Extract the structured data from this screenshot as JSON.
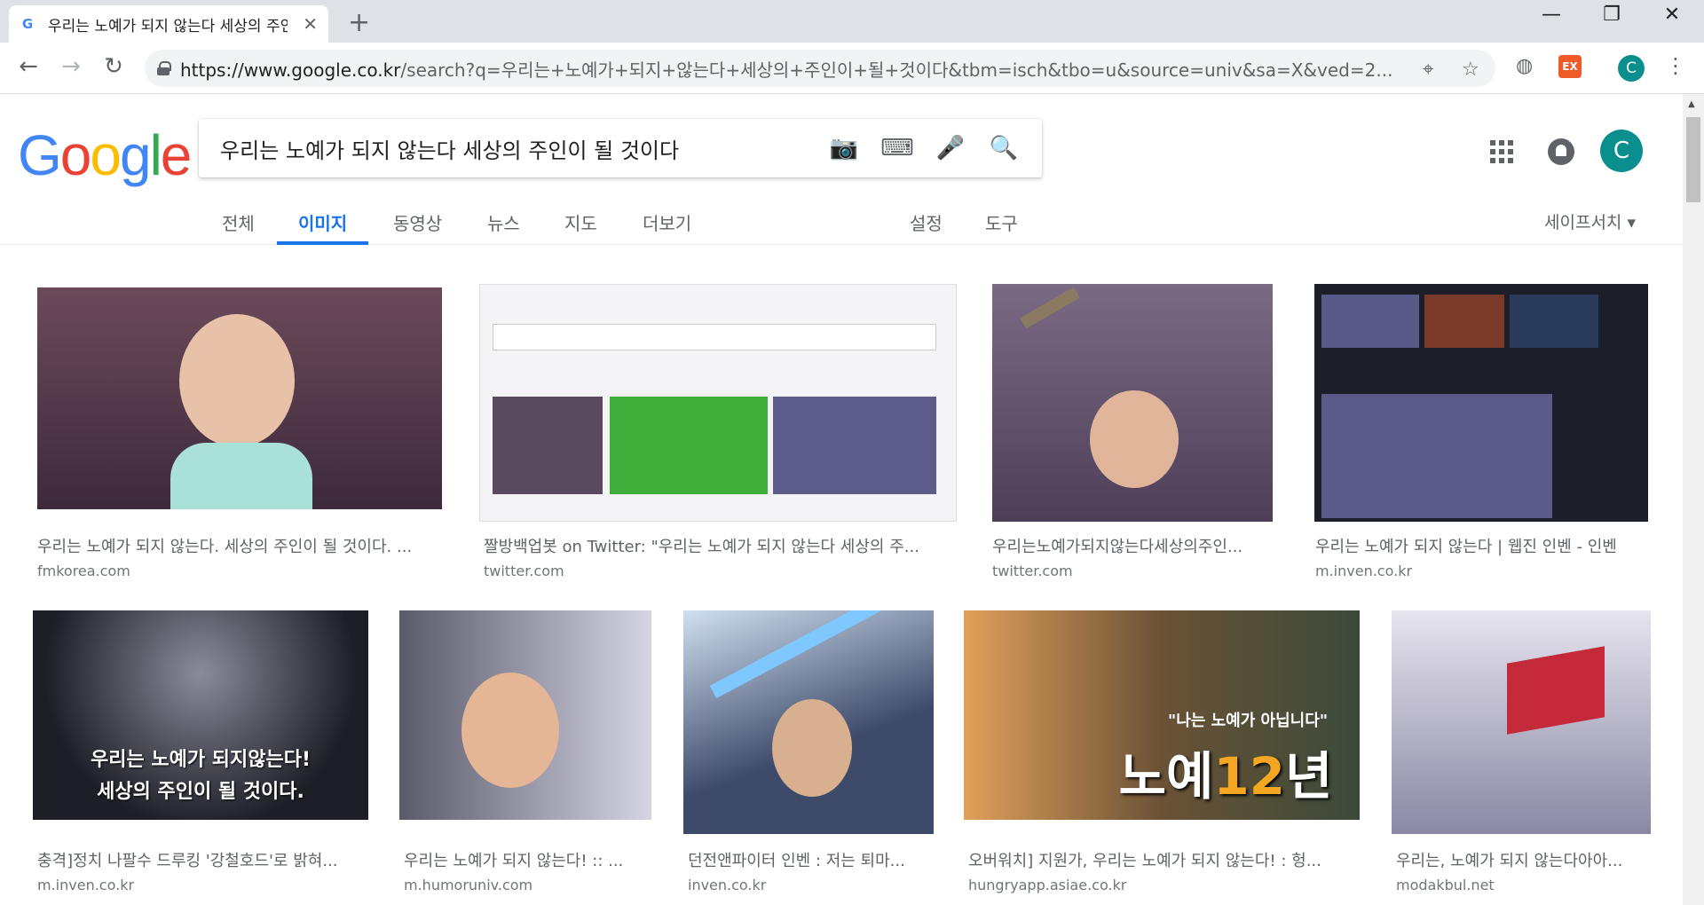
{
  "browser": {
    "tab_title": "우리는 노예가 되지 않는다 세상의 주인이 될 것이다 - Google 검색",
    "favicon": "G",
    "new_tab": "+",
    "minimize": "—",
    "restore": "❐",
    "close": "✕",
    "url_host": "https://www.google.co.kr",
    "url_path": "/search?q=우리는+노예가+되지+않는다+세상의+주인이+될+것이다&tbm=isch&tbo=u&source=univ&sa=X&ved=2...",
    "ext_label": "EX",
    "profile_initial": "C"
  },
  "search": {
    "query": "우리는 노예가 되지 않는다 세상의 주인이 될 것이다",
    "avatar_initial": "C"
  },
  "logo": [
    "G",
    "o",
    "o",
    "g",
    "l",
    "e"
  ],
  "tabs": {
    "all": "전체",
    "images": "이미지",
    "videos": "동영상",
    "news": "뉴스",
    "maps": "지도",
    "more": "더보기",
    "settings": "설정",
    "tools": "도구",
    "safesearch": "세이프서치 ▾"
  },
  "results": [
    {
      "title": "우리는 노예가 되지 않는다. 세상의 주인이 될 것이다. ...",
      "source": "fmkorea.com",
      "color": "#5a3a4a"
    },
    {
      "title": "짤방백업봇 on Twitter: \"우리는 노예가 되지 않는다 세상의 주...",
      "source": "twitter.com",
      "color": "#e6e6ea"
    },
    {
      "title": "우리는노예가되지않는다세상의주인...",
      "source": "twitter.com",
      "color": "#6e5a78"
    },
    {
      "title": "우리는 노예가 되지 않는다 | 웹진 인벤 - 인벤",
      "source": "m.inven.co.kr",
      "color": "#1c1f2a"
    },
    {
      "title": "충격]정치 나팔수 드루킹 '강철호드'로 밝혀...",
      "source": "m.inven.co.kr",
      "color": "#2a2a30",
      "caption1": "우리는 노예가 되지않는다!",
      "caption2": "세상의 주인이 될 것이다."
    },
    {
      "title": "우리는 노예가 되지 않는다! :: ...",
      "source": "m.humoruniv.com",
      "color": "#b8b4c8"
    },
    {
      "title": "던전앤파이터 인벤 : 저는 퇴마...",
      "source": "inven.co.kr",
      "color": "#3e4a6a"
    },
    {
      "title": "오버워치] 지원가, 우리는 노예가 되지 않는다! : 헝...",
      "source": "hungryapp.asiae.co.kr",
      "color": "#6a5236",
      "caption1": "\"나는 노예가 아닙니다\"",
      "caption2": "노예",
      "caption3": "12",
      "caption4": "년"
    },
    {
      "title": "우리는, 노예가 되지 않는다아아...",
      "source": "modakbul.net",
      "color": "#c9c6d6"
    }
  ]
}
